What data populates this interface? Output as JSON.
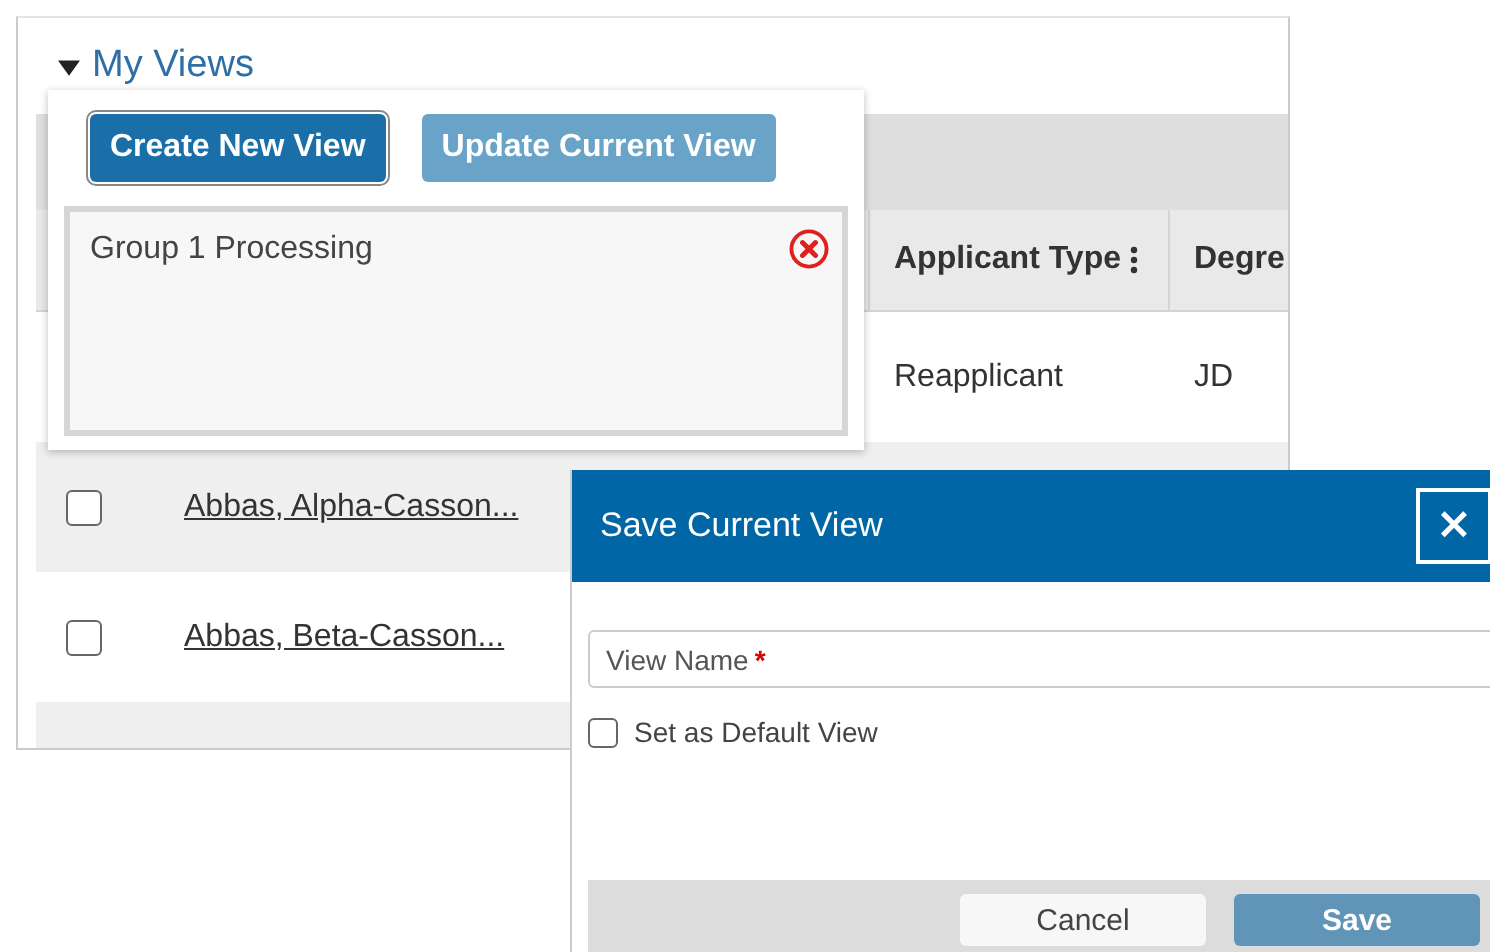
{
  "section": {
    "title": "My Views",
    "expanded": true
  },
  "table": {
    "columns": [
      {
        "label": "Applicant Type",
        "menu": true
      },
      {
        "label": "Degre"
      }
    ],
    "rows": [
      {
        "applicant_type": "Reapplicant",
        "degree": "JD"
      },
      {
        "checked": false,
        "name": "Abbas, Alpha-Casson..."
      },
      {
        "checked": false,
        "name": "Abbas, Beta-Casson..."
      }
    ]
  },
  "views_popover": {
    "buttons": [
      {
        "label": "Create New View",
        "kind": "primary"
      },
      {
        "label": "Update Current View",
        "kind": "secondary"
      }
    ],
    "views": [
      {
        "name": "Group 1 Processing"
      }
    ]
  },
  "dialog": {
    "title": "Save Current View",
    "close": "×",
    "field": {
      "placeholder": "View Name",
      "required_mark": "*"
    },
    "default_checkbox": {
      "label": "Set as Default View",
      "checked": false
    },
    "buttons": [
      {
        "label": "Cancel",
        "kind": "secondary"
      },
      {
        "label": "Save",
        "kind": "primary"
      }
    ]
  }
}
